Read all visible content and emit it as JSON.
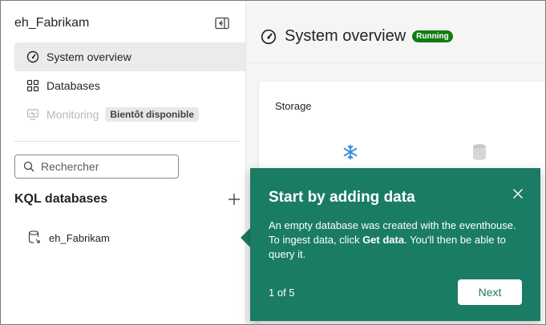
{
  "sidebar": {
    "workspace_title": "eh_Fabrikam",
    "nav": [
      {
        "label": "System overview",
        "icon": "gauge-icon",
        "active": true
      },
      {
        "label": "Databases",
        "icon": "grid-icon"
      },
      {
        "label": "Monitoring",
        "icon": "monitor-icon",
        "disabled": true,
        "badge": "Bientôt disponible"
      }
    ],
    "search_placeholder": "Rechercher",
    "section_title": "KQL databases",
    "databases": [
      {
        "label": "eh_Fabrikam",
        "icon": "database-icon"
      }
    ]
  },
  "main": {
    "title": "System overview",
    "status": "Running",
    "card_title": "Storage"
  },
  "teaching_bubble": {
    "title": "Start by adding data",
    "body_prefix": "An empty database was created with the eventhouse. To ingest data, click ",
    "body_bold": "Get data",
    "body_suffix": ". You'll then be able to query it.",
    "step": "1 of 5",
    "next_label": "Next"
  },
  "colors": {
    "bubble": "#1a7c65",
    "running_badge": "#107c10",
    "snowflake": "#2f8ad8"
  }
}
